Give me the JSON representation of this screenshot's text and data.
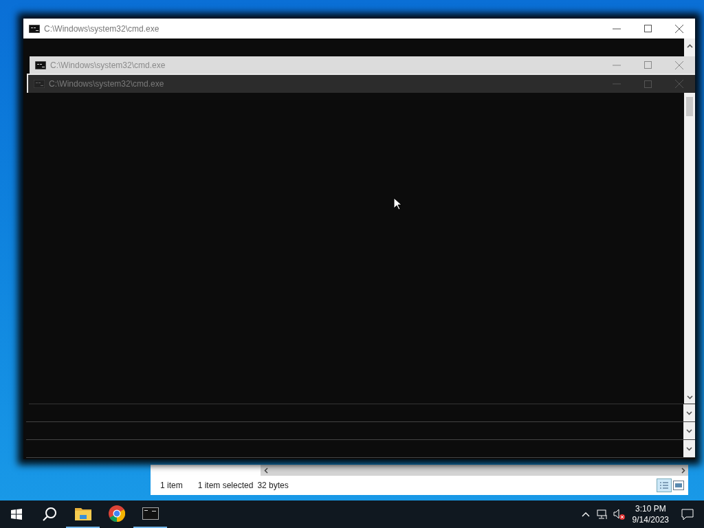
{
  "windows": [
    {
      "title": "C:\\Windows\\system32\\cmd.exe",
      "kind": "front"
    },
    {
      "title": "C:\\Windows\\system32\\cmd.exe",
      "kind": "ghost"
    },
    {
      "title": "C:\\Windows\\system32\\cmd.exe",
      "kind": "faded"
    }
  ],
  "explorer_status": {
    "count": "1 item",
    "selection": "1 item selected",
    "size": "32 bytes"
  },
  "taskbar": {
    "apps": [
      {
        "kind": "explorer",
        "running": true
      },
      {
        "kind": "chrome",
        "running": false
      },
      {
        "kind": "cmd",
        "running": true
      }
    ],
    "time": "3:10 PM",
    "date": "9/14/2023"
  }
}
